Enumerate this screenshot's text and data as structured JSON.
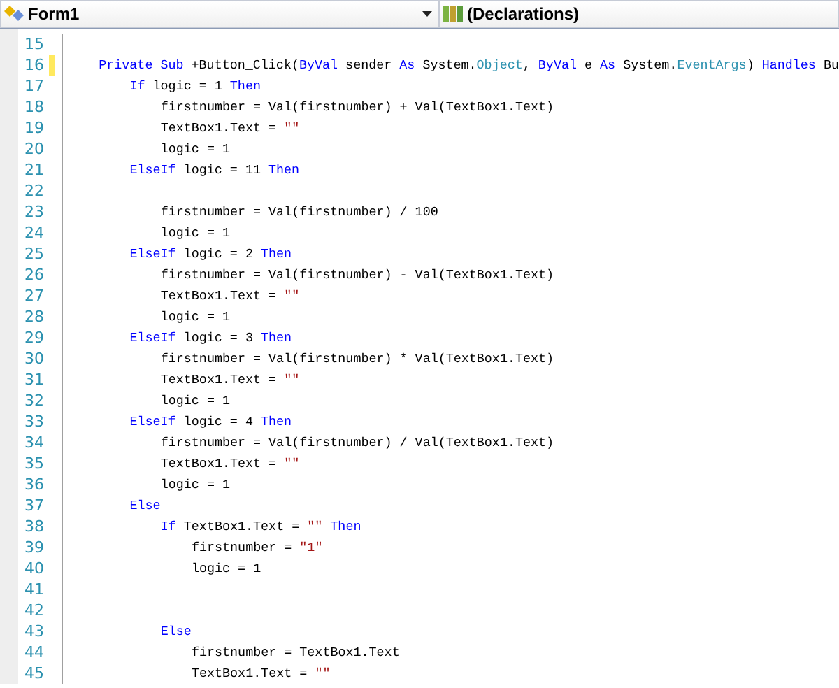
{
  "header": {
    "object_dropdown": {
      "label": "Form1"
    },
    "member_dropdown": {
      "label": "(Declarations)"
    }
  },
  "lines": [
    {
      "number": "15",
      "changed": false
    },
    {
      "number": "16",
      "changed": true,
      "tokens": [
        {
          "kind": "keyword",
          "text": "    Private Sub"
        },
        {
          "kind": "plain",
          "text": " +Button_Click("
        },
        {
          "kind": "keyword",
          "text": "ByVal"
        },
        {
          "kind": "plain",
          "text": " sender "
        },
        {
          "kind": "keyword",
          "text": "As"
        },
        {
          "kind": "plain",
          "text": " System."
        },
        {
          "kind": "type",
          "text": "Object"
        },
        {
          "kind": "plain",
          "text": ", "
        },
        {
          "kind": "keyword",
          "text": "ByVal"
        },
        {
          "kind": "plain",
          "text": " e "
        },
        {
          "kind": "keyword",
          "text": "As"
        },
        {
          "kind": "plain",
          "text": " System."
        },
        {
          "kind": "type",
          "text": "EventArgs"
        },
        {
          "kind": "plain",
          "text": ") "
        },
        {
          "kind": "keyword",
          "text": "Handles"
        },
        {
          "kind": "plain",
          "text": " Bu"
        }
      ]
    },
    {
      "number": "17",
      "changed": false,
      "tokens": [
        {
          "kind": "keyword",
          "text": "        If"
        },
        {
          "kind": "plain",
          "text": " logic = 1 "
        },
        {
          "kind": "keyword",
          "text": "Then"
        }
      ]
    },
    {
      "number": "18",
      "changed": false,
      "tokens": [
        {
          "kind": "plain",
          "text": "            firstnumber = Val(firstnumber) + Val(TextBox1.Text)"
        }
      ]
    },
    {
      "number": "19",
      "changed": false,
      "tokens": [
        {
          "kind": "plain",
          "text": "            TextBox1.Text = "
        },
        {
          "kind": "string",
          "text": "\"\""
        }
      ]
    },
    {
      "number": "20",
      "changed": false,
      "tokens": [
        {
          "kind": "plain",
          "text": "            logic = 1"
        }
      ]
    },
    {
      "number": "21",
      "changed": false,
      "tokens": [
        {
          "kind": "keyword",
          "text": "        ElseIf"
        },
        {
          "kind": "plain",
          "text": " logic = 11 "
        },
        {
          "kind": "keyword",
          "text": "Then"
        }
      ]
    },
    {
      "number": "22",
      "changed": false
    },
    {
      "number": "23",
      "changed": false,
      "tokens": [
        {
          "kind": "plain",
          "text": "            firstnumber = Val(firstnumber) / 100"
        }
      ]
    },
    {
      "number": "24",
      "changed": false,
      "tokens": [
        {
          "kind": "plain",
          "text": "            logic = 1"
        }
      ]
    },
    {
      "number": "25",
      "changed": false,
      "tokens": [
        {
          "kind": "keyword",
          "text": "        ElseIf"
        },
        {
          "kind": "plain",
          "text": " logic = 2 "
        },
        {
          "kind": "keyword",
          "text": "Then"
        }
      ]
    },
    {
      "number": "26",
      "changed": false,
      "tokens": [
        {
          "kind": "plain",
          "text": "            firstnumber = Val(firstnumber) - Val(TextBox1.Text)"
        }
      ]
    },
    {
      "number": "27",
      "changed": false,
      "tokens": [
        {
          "kind": "plain",
          "text": "            TextBox1.Text = "
        },
        {
          "kind": "string",
          "text": "\"\""
        }
      ]
    },
    {
      "number": "28",
      "changed": false,
      "tokens": [
        {
          "kind": "plain",
          "text": "            logic = 1"
        }
      ]
    },
    {
      "number": "29",
      "changed": false,
      "tokens": [
        {
          "kind": "keyword",
          "text": "        ElseIf"
        },
        {
          "kind": "plain",
          "text": " logic = 3 "
        },
        {
          "kind": "keyword",
          "text": "Then"
        }
      ]
    },
    {
      "number": "30",
      "changed": false,
      "tokens": [
        {
          "kind": "plain",
          "text": "            firstnumber = Val(firstnumber) * Val(TextBox1.Text)"
        }
      ]
    },
    {
      "number": "31",
      "changed": false,
      "tokens": [
        {
          "kind": "plain",
          "text": "            TextBox1.Text = "
        },
        {
          "kind": "string",
          "text": "\"\""
        }
      ]
    },
    {
      "number": "32",
      "changed": false,
      "tokens": [
        {
          "kind": "plain",
          "text": "            logic = 1"
        }
      ]
    },
    {
      "number": "33",
      "changed": false,
      "tokens": [
        {
          "kind": "keyword",
          "text": "        ElseIf"
        },
        {
          "kind": "plain",
          "text": " logic = 4 "
        },
        {
          "kind": "keyword",
          "text": "Then"
        }
      ]
    },
    {
      "number": "34",
      "changed": false,
      "tokens": [
        {
          "kind": "plain",
          "text": "            firstnumber = Val(firstnumber) / Val(TextBox1.Text)"
        }
      ]
    },
    {
      "number": "35",
      "changed": false,
      "tokens": [
        {
          "kind": "plain",
          "text": "            TextBox1.Text = "
        },
        {
          "kind": "string",
          "text": "\"\""
        }
      ]
    },
    {
      "number": "36",
      "changed": false,
      "tokens": [
        {
          "kind": "plain",
          "text": "            logic = 1"
        }
      ]
    },
    {
      "number": "37",
      "changed": false,
      "tokens": [
        {
          "kind": "keyword",
          "text": "        Else"
        }
      ]
    },
    {
      "number": "38",
      "changed": false,
      "tokens": [
        {
          "kind": "keyword",
          "text": "            If"
        },
        {
          "kind": "plain",
          "text": " TextBox1.Text = "
        },
        {
          "kind": "string",
          "text": "\"\""
        },
        {
          "kind": "keyword",
          "text": " Then"
        }
      ]
    },
    {
      "number": "39",
      "changed": false,
      "tokens": [
        {
          "kind": "plain",
          "text": "                firstnumber = "
        },
        {
          "kind": "string",
          "text": "\"1\""
        }
      ]
    },
    {
      "number": "40",
      "changed": false,
      "tokens": [
        {
          "kind": "plain",
          "text": "                logic = 1"
        }
      ]
    },
    {
      "number": "41",
      "changed": false
    },
    {
      "number": "42",
      "changed": false
    },
    {
      "number": "43",
      "changed": false,
      "tokens": [
        {
          "kind": "keyword",
          "text": "            Else"
        }
      ]
    },
    {
      "number": "44",
      "changed": false,
      "tokens": [
        {
          "kind": "plain",
          "text": "                firstnumber = TextBox1.Text"
        }
      ]
    },
    {
      "number": "45",
      "changed": false,
      "tokens": [
        {
          "kind": "plain",
          "text": "                TextBox1.Text = "
        },
        {
          "kind": "string",
          "text": "\"\""
        }
      ]
    }
  ]
}
